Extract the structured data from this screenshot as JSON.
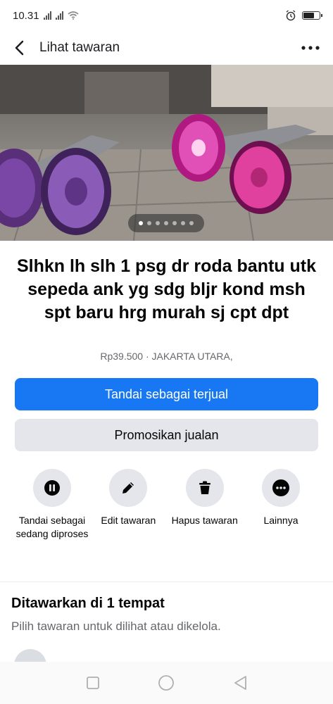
{
  "status_bar": {
    "time": "10.31",
    "signal1": "x",
    "signal2": "x",
    "battery_level": 0.7
  },
  "header": {
    "title": "Lihat tawaran",
    "back_icon": "chevron-left-icon",
    "more_icon": "more-dots-icon"
  },
  "photo": {
    "total_images": 7,
    "active_index": 0
  },
  "listing": {
    "title": "Slhkn lh slh 1 psg dr roda bantu utk sepeda ank yg sdg bljr kond msh spt baru hrg murah sj cpt dpt",
    "meta": "Rp39.500 · JAKARTA UTARA,"
  },
  "buttons": {
    "mark_sold": "Tandai sebagai terjual",
    "promote": "Promosikan jualan"
  },
  "actions": [
    {
      "label": "Tandai sebagai sedang diproses",
      "icon": "pause-icon"
    },
    {
      "label": "Edit tawaran",
      "icon": "pencil-icon"
    },
    {
      "label": "Hapus tawaran",
      "icon": "trash-icon"
    },
    {
      "label": "Lainnya",
      "icon": "more-dots-icon"
    }
  ],
  "offered": {
    "title": "Ditawarkan di 1 tempat",
    "subtitle": "Pilih tawaran untuk dilihat atau dikelola."
  },
  "colors": {
    "primary": "#1877f2",
    "secondary_bg": "#e4e6eb",
    "muted_text": "#65676b"
  }
}
